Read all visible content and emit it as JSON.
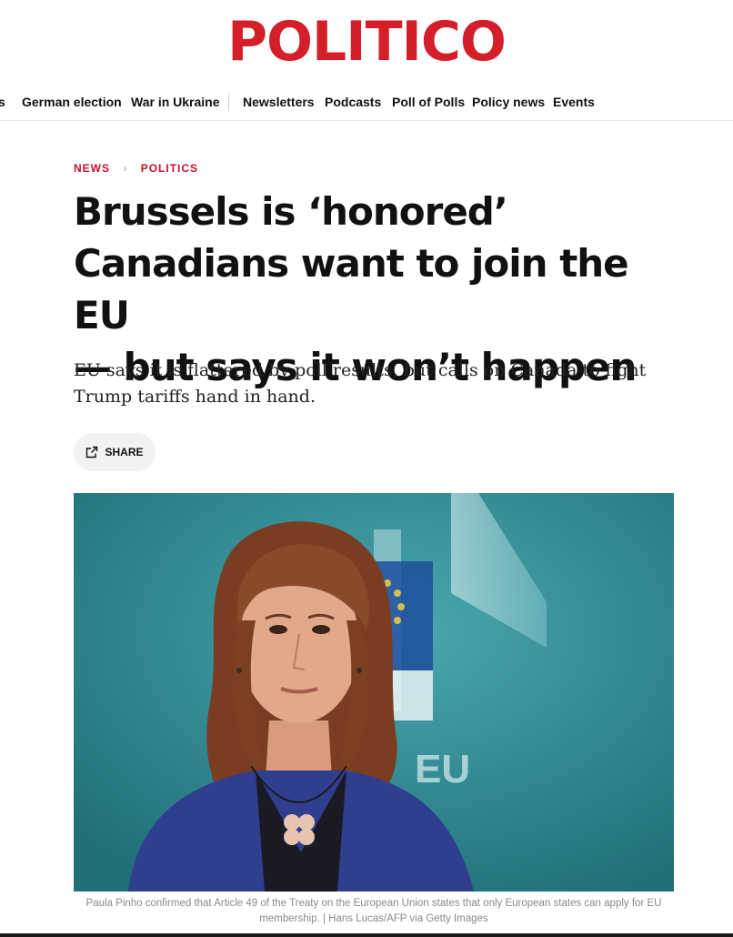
{
  "brand": {
    "logo_text": "POLITICO",
    "logo_color": "#d41e2a"
  },
  "nav": {
    "items": [
      {
        "label": "s"
      },
      {
        "label": "German election"
      },
      {
        "label": "War in Ukraine"
      },
      {
        "label": "Newsletters"
      },
      {
        "label": "Podcasts"
      },
      {
        "label": "Poll of Polls"
      },
      {
        "label": "Policy news"
      },
      {
        "label": "Events"
      }
    ]
  },
  "breadcrumb": {
    "items": [
      {
        "label": "NEWS"
      },
      {
        "label": "POLITICS"
      }
    ],
    "accent_color": "#c8102e"
  },
  "article": {
    "headline_lines": [
      "Brussels is ‘honored’",
      "Canadians want to join the EU",
      "— but says it won’t happen"
    ],
    "dek": "EU says it is flattered by poll results, but calls on Canada to fight Trump tariffs hand in hand.",
    "share_label": "SHARE",
    "image": {
      "overlay_text": "EU",
      "caption": "Paula Pinho confirmed that Article 49 of the Treaty on the European Union states that only European states can apply for EU membership. | Hans Lucas/AFP via Getty Images"
    }
  },
  "colors": {
    "photo_background": "#2d8a92",
    "jacket": "#2f3e8e",
    "hair": "#8a4a2a"
  },
  "icons": {
    "share": "share-external-icon",
    "separator": "chevron-right-icon"
  }
}
